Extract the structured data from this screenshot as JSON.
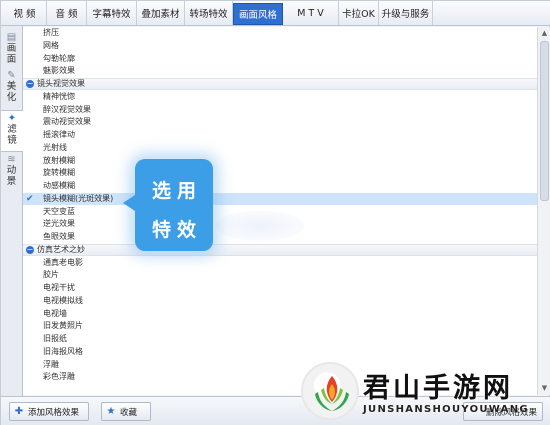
{
  "top_tabs": [
    "视 频",
    "音 频",
    "字幕特效",
    "叠加素材",
    "转场特效",
    "画面风格",
    "M T V",
    "卡拉OK",
    "升级与服务"
  ],
  "active_tab": "画面风格",
  "side_tabs": [
    {
      "label": "画面",
      "icon": "grid-icon"
    },
    {
      "label": "美化",
      "icon": "wand-icon"
    },
    {
      "label": "滤镜",
      "icon": "magic-wand-icon"
    },
    {
      "label": "动景",
      "icon": "wave-icon"
    }
  ],
  "active_side_tab": "滤镜",
  "effect_list": [
    {
      "type": "item",
      "label": "挤压"
    },
    {
      "type": "item",
      "label": "网格"
    },
    {
      "type": "item",
      "label": "勾勒轮廓"
    },
    {
      "type": "item",
      "label": "魅影效果"
    },
    {
      "type": "category",
      "label": "镜头视觉效果"
    },
    {
      "type": "item",
      "label": "精神恍惚"
    },
    {
      "type": "item",
      "label": "醉汉视觉效果"
    },
    {
      "type": "item",
      "label": "震动视觉效果"
    },
    {
      "type": "item",
      "label": "摇滚律动"
    },
    {
      "type": "item",
      "label": "光射线"
    },
    {
      "type": "item",
      "label": "放射模糊"
    },
    {
      "type": "item",
      "label": "旋转模糊"
    },
    {
      "type": "item",
      "label": "动感模糊"
    },
    {
      "type": "selected",
      "label": "镜头模糊(光斑效果)"
    },
    {
      "type": "item",
      "label": "天空变蓝"
    },
    {
      "type": "item",
      "label": "逆光效果"
    },
    {
      "type": "item",
      "label": "鱼眼效果"
    },
    {
      "type": "category",
      "label": "仿真艺术之妙"
    },
    {
      "type": "item",
      "label": "通真老电影"
    },
    {
      "type": "item",
      "label": "胶片"
    },
    {
      "type": "item",
      "label": "电视干扰"
    },
    {
      "type": "item",
      "label": "电视模拟线"
    },
    {
      "type": "item",
      "label": "电视墙"
    },
    {
      "type": "item",
      "label": "旧发黄照片"
    },
    {
      "type": "item",
      "label": "旧报纸"
    },
    {
      "type": "item",
      "label": "旧海报风格"
    },
    {
      "type": "item",
      "label": "浮雕"
    },
    {
      "type": "item",
      "label": "彩色浮雕"
    }
  ],
  "callout": {
    "line1": "选用",
    "line2": "特效"
  },
  "bottom": {
    "add_button": "添加风格效果",
    "add_icon": "add-effect-icon",
    "fav_button": "收藏",
    "fav_icon": "favorite-icon",
    "delete_button": "删除风格效果"
  },
  "watermark": {
    "title": "君山手游网",
    "url": "JUNSHANSHOUYOUWANG"
  },
  "colors": {
    "accent": "#2f6fd0",
    "callout": "#3b9ee6",
    "selected_row": "#cfe3fb"
  }
}
